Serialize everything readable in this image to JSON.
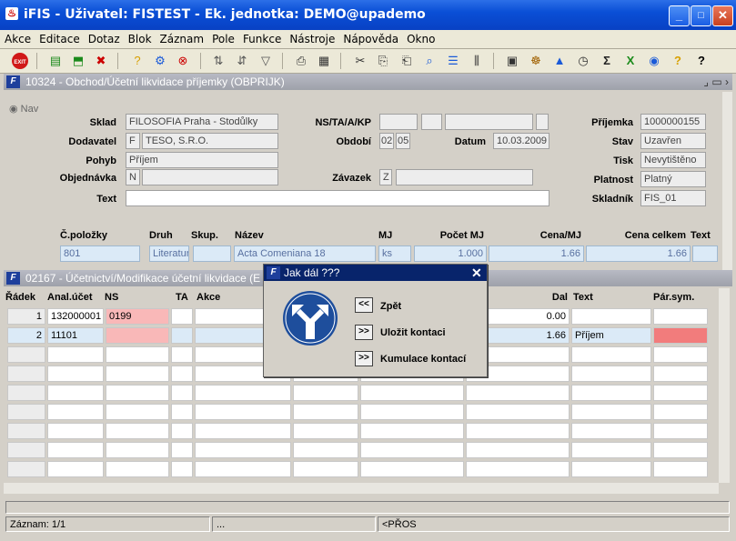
{
  "window": {
    "title": "iFIS - Uživatel: FISTEST - Ek. jednotka: DEMO@upademo",
    "minimize": "_",
    "maximize": "□",
    "close": "✕"
  },
  "menu": [
    "Akce",
    "Editace",
    "Dotaz",
    "Blok",
    "Záznam",
    "Pole",
    "Funkce",
    "Nástroje",
    "Nápověda",
    "Okno"
  ],
  "toolbar": {
    "exit_label": "EXIT"
  },
  "form1": {
    "title": "10324 - Obchod/Účetní likvidace příjemky (OBPRIJK)",
    "nav_label": "Nav",
    "labels": {
      "sklad": "Sklad",
      "dodavatel": "Dodavatel",
      "pohyb": "Pohyb",
      "objednavka": "Objednávka",
      "text": "Text",
      "ns": "NS/TA/A/KP",
      "obdobi": "Období",
      "datum": "Datum",
      "zavazek": "Závazek",
      "prijemka": "Příjemka",
      "stav": "Stav",
      "tisk": "Tisk",
      "platnost": "Platnost",
      "skladnik": "Skladník"
    },
    "values": {
      "sklad": "FILOSOFIA Praha - Stodůlky",
      "dodavatel_flag": "F",
      "dodavatel": "TESO, S.R.O.",
      "pohyb": "Příjem",
      "objednavka_flag": "N",
      "obdobi_1": "02",
      "obdobi_2": "05",
      "datum": "10.03.2009",
      "zavazek_flag": "Z",
      "prijemka": "1000000155",
      "stav": "Uzavřen",
      "tisk": "Nevytištěno",
      "platnost": "Platný",
      "skladnik": "FIS_01"
    },
    "columns": {
      "cpolozky": "Č.položky",
      "druh": "Druh",
      "skup": "Skup.",
      "nazev": "Název",
      "mj": "MJ",
      "pocet": "Počet MJ",
      "cena": "Cena/MJ",
      "celkem": "Cena celkem",
      "text": "Text"
    },
    "row": {
      "cpolozky": "801",
      "druh": "Literatur",
      "nazev": "Acta Comeniana 18",
      "mj": "ks",
      "pocet": "1.000",
      "cena": "1.66",
      "celkem": "1.66"
    }
  },
  "form2": {
    "title": "02167 - Účetnictví/Modifikace účetní likvidace (E",
    "columns": {
      "radek": "Řádek",
      "anal": "Anal.účet",
      "ns": "NS",
      "ta": "TA",
      "akce": "Akce",
      "dal": "Dal",
      "text": "Text",
      "parsym": "Pár.sym."
    },
    "rows": [
      {
        "radek": "1",
        "anal": "132000001",
        "ns": "0199",
        "dal": "0.00",
        "text": ""
      },
      {
        "radek": "2",
        "anal": "11101",
        "ns": "",
        "dal": "1.66",
        "text": "Příjem"
      }
    ]
  },
  "dialog": {
    "title": "Jak dál ???",
    "buttons": [
      {
        "glyph": "<<",
        "label": "Zpět"
      },
      {
        "glyph": ">>",
        "label": "Uložit kontaci"
      },
      {
        "glyph": ">>",
        "label": "Kumulace kontací"
      }
    ]
  },
  "status": {
    "record": "Záznam: 1/1",
    "ellipsis": "...",
    "mode": "<PŘOS"
  },
  "colors": {
    "titlebar": "#0a4fd6",
    "dialog_title": "#08246b",
    "sign_blue": "#1e4e9c",
    "pink": "#f9b8b8"
  }
}
